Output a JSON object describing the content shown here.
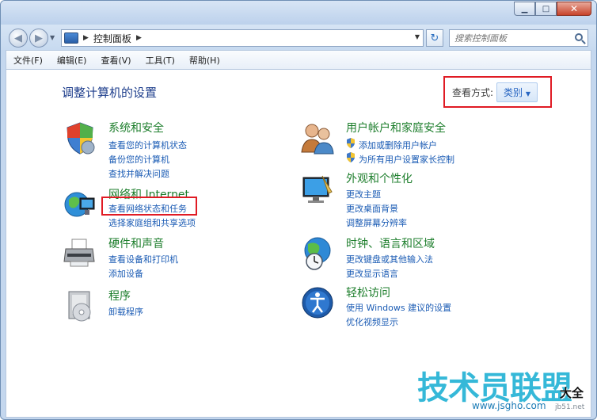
{
  "window": {
    "minimize": "▁",
    "maximize": "□",
    "close": "✕"
  },
  "address": {
    "path_segment": "控制面板"
  },
  "search": {
    "placeholder": "搜索控制面板"
  },
  "menu": [
    "文件(F)",
    "编辑(E)",
    "查看(V)",
    "工具(T)",
    "帮助(H)"
  ],
  "page": {
    "title": "调整计算机的设置"
  },
  "view_by": {
    "label": "查看方式:",
    "value": "类别"
  },
  "categories": [
    {
      "name": "system-security",
      "icon": "shield-icon",
      "title": "系统和安全",
      "links": [
        "查看您的计算机状态",
        "备份您的计算机",
        "查找并解决问题"
      ]
    },
    {
      "name": "network-internet",
      "icon": "network-icon",
      "title": "网络和 Internet",
      "links": [
        "查看网络状态和任务",
        "选择家庭组和共享选项"
      ]
    },
    {
      "name": "hardware-sound",
      "icon": "printer-icon",
      "title": "硬件和声音",
      "links": [
        "查看设备和打印机",
        "添加设备"
      ]
    },
    {
      "name": "programs",
      "icon": "programs-icon",
      "title": "程序",
      "links": [
        "卸载程序"
      ]
    },
    {
      "name": "user-accounts",
      "icon": "users-icon",
      "title": "用户帐户和家庭安全",
      "links": [
        "添加或删除用户帐户",
        "为所有用户设置家长控制"
      ]
    },
    {
      "name": "appearance",
      "icon": "appearance-icon",
      "title": "外观和个性化",
      "links": [
        "更改主题",
        "更改桌面背景",
        "调整屏幕分辨率"
      ]
    },
    {
      "name": "clock-region",
      "icon": "globe-clock-icon",
      "title": "时钟、语言和区域",
      "links": [
        "更改键盘或其他输入法",
        "更改显示语言"
      ]
    },
    {
      "name": "ease-of-access",
      "icon": "ease-access-icon",
      "title": "轻松访问",
      "links": [
        "使用 Windows 建议的设置",
        "优化视频显示"
      ]
    }
  ],
  "watermark": {
    "brand": "技术员联盟",
    "suffix": "大全",
    "url": "www.jsgho.com",
    "small": "jb51.net"
  }
}
